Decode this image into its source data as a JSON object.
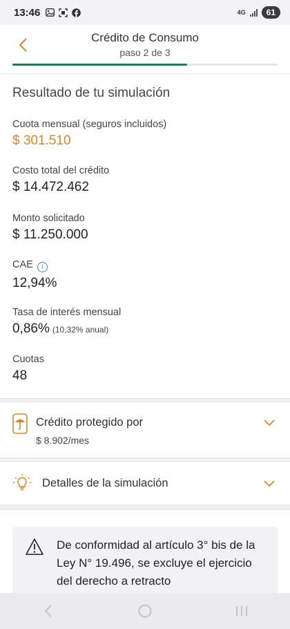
{
  "status_bar": {
    "time": "13:46",
    "network": "4G",
    "battery": "61"
  },
  "header": {
    "title": "Crédito de Consumo",
    "subtitle": "paso 2 de 3",
    "progress_fraction": 0.66
  },
  "result": {
    "section_title": "Resultado de tu simulación",
    "fields": [
      {
        "label": "Cuota mensual (seguros incluidos)",
        "value": "$ 301.510"
      },
      {
        "label": "Costo total del crédito",
        "value": "$ 14.472.462"
      },
      {
        "label": "Monto solicitado",
        "value": "$ 11.250.000"
      },
      {
        "label": "CAE",
        "value": "12,94%"
      },
      {
        "label": "Tasa de interés mensual",
        "value": "0,86%",
        "note": "(10,32% anual)"
      },
      {
        "label": "Cuotas",
        "value": "48"
      }
    ]
  },
  "protection": {
    "title": "Crédito protegido por",
    "amount": "$ 8.902/mes"
  },
  "details": {
    "title": "Detalles de la simulación"
  },
  "notice": {
    "text": "De conformidad al artículo 3° bis de la Ley N° 19.496, se excluye el ejercicio del derecho a retracto"
  },
  "colors": {
    "accent": "#d08a2c",
    "progress": "#1f7a52",
    "info": "#4a7fc1"
  }
}
